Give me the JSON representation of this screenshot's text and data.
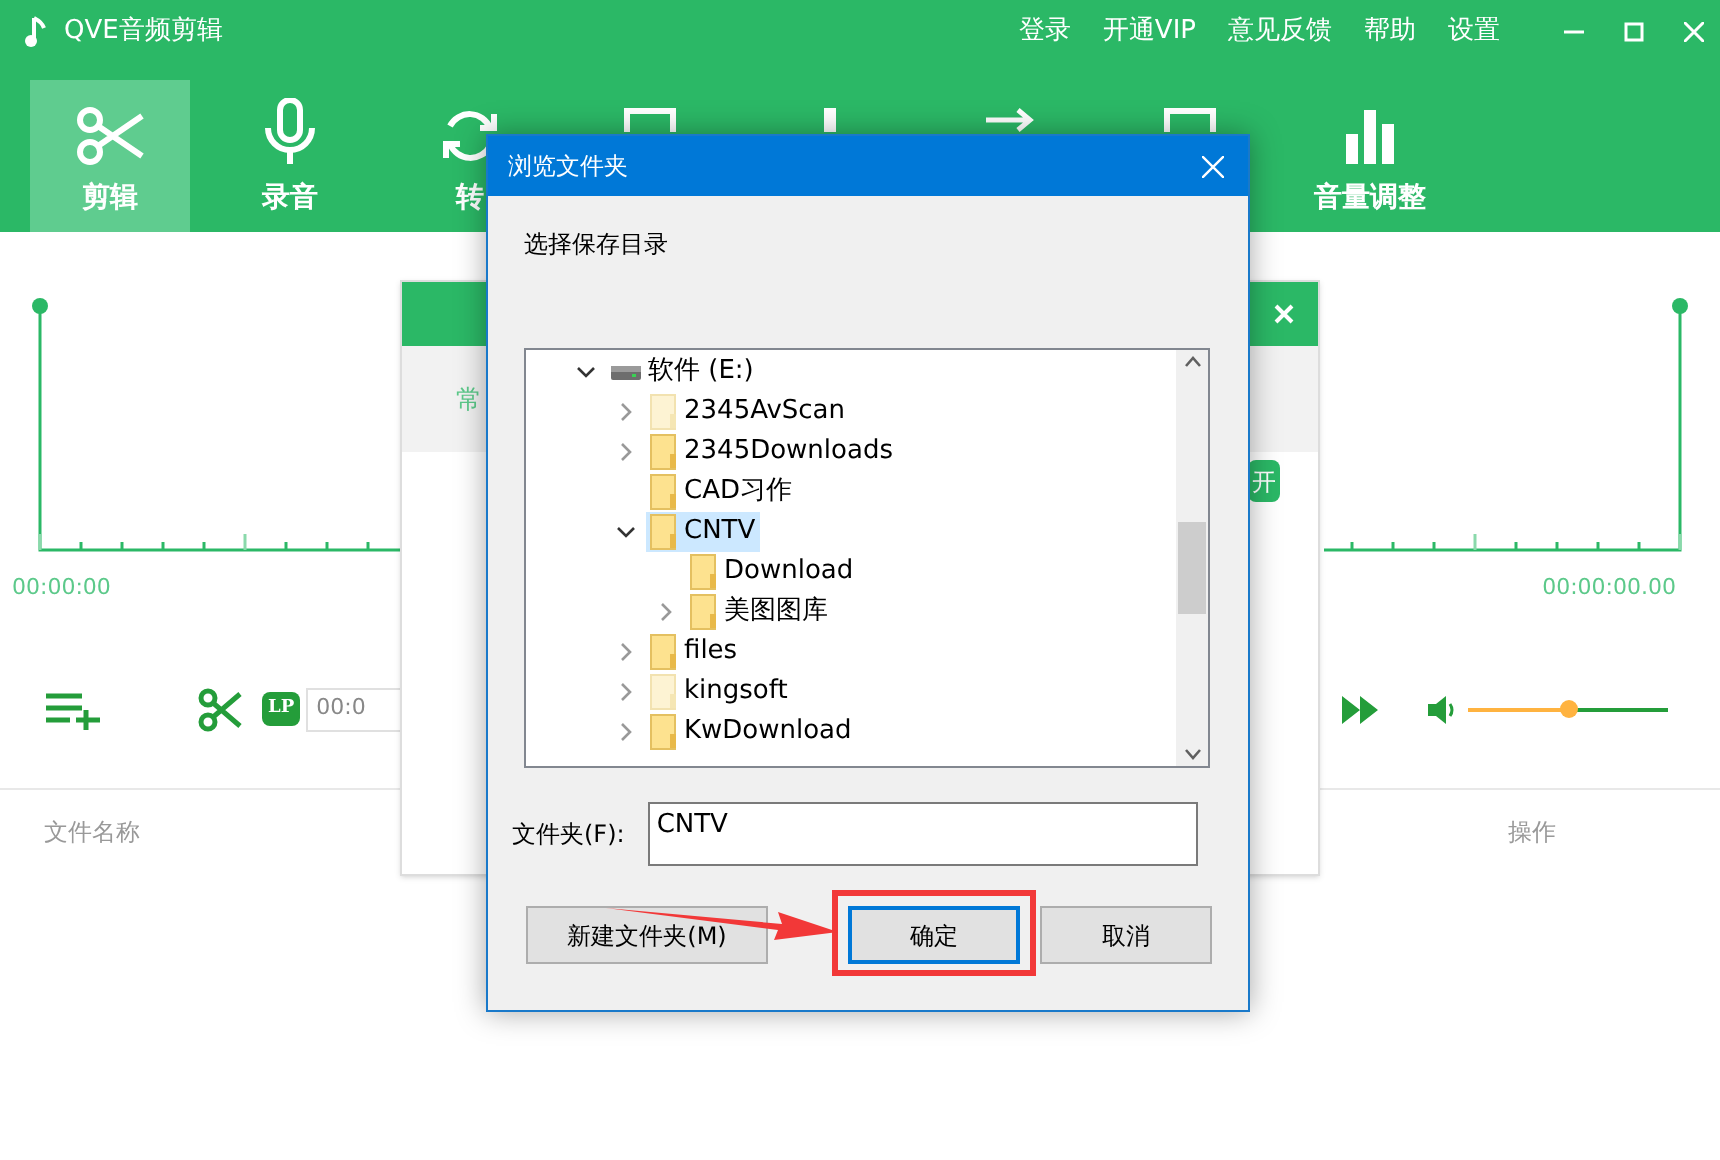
{
  "window": {
    "title": "QVE音频剪辑",
    "menu": [
      "登录",
      "开通VIP",
      "意见反馈",
      "帮助",
      "设置"
    ]
  },
  "tabs": [
    {
      "label": "剪辑",
      "kind": "scissors",
      "selected": true
    },
    {
      "label": "录音",
      "kind": "mic",
      "selected": false
    },
    {
      "label": "转",
      "kind": "convert",
      "selected": false
    },
    {
      "kind": "box",
      "selected": false
    },
    {
      "kind": "bar",
      "selected": false
    },
    {
      "kind": "arrows",
      "selected": false
    },
    {
      "kind": "box",
      "selected": false
    },
    {
      "label": "音量调整",
      "kind": "chart",
      "selected": false
    }
  ],
  "editor": {
    "start_time": "00:00:00",
    "end_time": "00:00:00.00",
    "lp_badge": "LP",
    "time_field": "00:0",
    "volume": {
      "level": 0.5
    }
  },
  "file_list": {
    "columns": [
      "文件名称",
      "操作"
    ]
  },
  "back_dialog": {
    "tab": "常",
    "button": "开"
  },
  "dialog": {
    "title": "浏览文件夹",
    "prompt": "选择保存目录",
    "tree": [
      {
        "label": "软件 (E:)",
        "kind": "drive",
        "expandable": true,
        "expanded": true,
        "selected": false,
        "children": [
          {
            "label": "2345AvScan",
            "kind": "folder",
            "faded": true,
            "expandable": true,
            "expanded": false,
            "selected": false
          },
          {
            "label": "2345Downloads",
            "kind": "folder",
            "faded": false,
            "expandable": true,
            "expanded": false,
            "selected": false
          },
          {
            "label": "CAD习作",
            "kind": "folder",
            "faded": false,
            "expandable": false,
            "selected": false
          },
          {
            "label": "CNTV",
            "kind": "folder",
            "faded": false,
            "expandable": true,
            "expanded": true,
            "selected": true,
            "children": [
              {
                "label": "Download",
                "kind": "folder",
                "faded": false,
                "expandable": false,
                "selected": false
              },
              {
                "label": "美图图库",
                "kind": "folder",
                "faded": false,
                "expandable": true,
                "expanded": false,
                "selected": false
              }
            ]
          },
          {
            "label": "files",
            "kind": "folder",
            "faded": false,
            "expandable": true,
            "expanded": false,
            "selected": false
          },
          {
            "label": "kingsoft",
            "kind": "folder",
            "faded": true,
            "expandable": true,
            "expanded": false,
            "selected": false
          },
          {
            "label": "KwDownload",
            "kind": "folder",
            "faded": false,
            "expandable": true,
            "expanded": false,
            "selected": false
          }
        ]
      }
    ],
    "folder_label": "文件夹(F):",
    "folder_value": "CNTV",
    "buttons": [
      {
        "label": "新建文件夹(M)",
        "focused": false,
        "highlighted": false
      },
      {
        "label": "确定",
        "focused": true,
        "highlighted": true
      },
      {
        "label": "取消",
        "focused": false,
        "highlighted": false
      }
    ]
  }
}
